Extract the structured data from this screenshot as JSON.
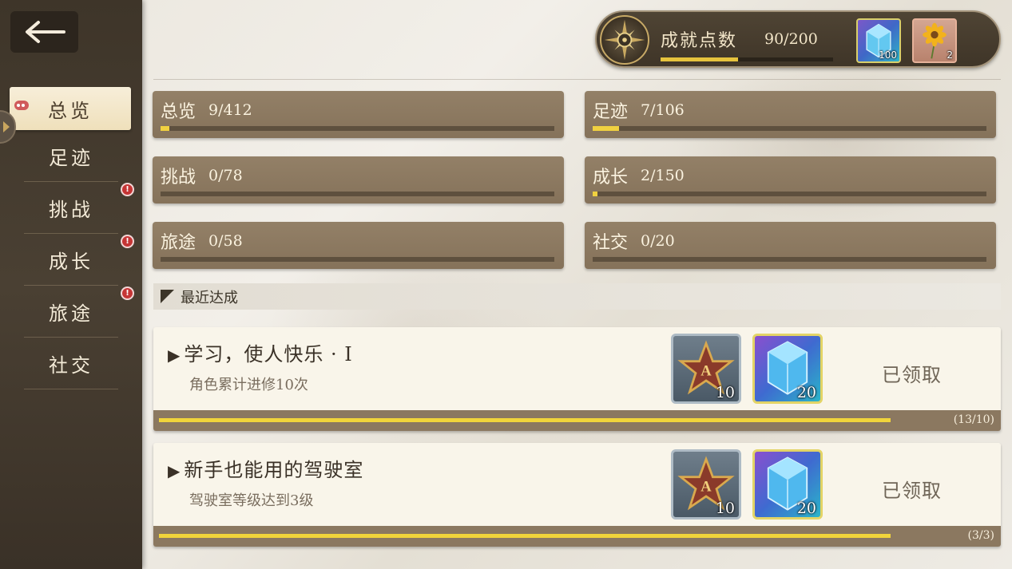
{
  "header": {
    "points_label": "成就点数",
    "points_value": "90/200",
    "points_progress": 0.45,
    "rewards": [
      {
        "icon": "blue-crystal-icon",
        "count": "100"
      },
      {
        "icon": "sunflower-icon",
        "count": "2"
      }
    ]
  },
  "sidebar": {
    "back_icon": "back-arrow-icon",
    "items": [
      {
        "label": "总览",
        "active": true,
        "alert": false
      },
      {
        "label": "足迹",
        "active": false,
        "alert": false
      },
      {
        "label": "挑战",
        "active": false,
        "alert": true
      },
      {
        "label": "成长",
        "active": false,
        "alert": true
      },
      {
        "label": "旅途",
        "active": false,
        "alert": true
      },
      {
        "label": "社交",
        "active": false,
        "alert": false
      }
    ],
    "alert_symbol": "!"
  },
  "categories": [
    {
      "name": "总览",
      "count": "9/412",
      "progress": 0.022
    },
    {
      "name": "足迹",
      "count": "7/106",
      "progress": 0.066
    },
    {
      "name": "挑战",
      "count": "0/78",
      "progress": 0
    },
    {
      "name": "成长",
      "count": "2/150",
      "progress": 0.013
    },
    {
      "name": "旅途",
      "count": "0/58",
      "progress": 0
    },
    {
      "name": "社交",
      "count": "0/20",
      "progress": 0
    }
  ],
  "recent": {
    "title": "最近达成",
    "achievements": [
      {
        "title": "学习，使人快乐 · Ⅰ",
        "desc": "角色累计进修10次",
        "rewards": [
          {
            "icon": "a-rank-star-icon",
            "count": "10"
          },
          {
            "icon": "blue-crystal-icon",
            "count": "20"
          }
        ],
        "status": "已领取",
        "progress_text": "(13/10)",
        "progress": 1.0
      },
      {
        "title": "新手也能用的驾驶室",
        "desc": "驾驶室等级达到3级",
        "rewards": [
          {
            "icon": "a-rank-star-icon",
            "count": "10"
          },
          {
            "icon": "blue-crystal-icon",
            "count": "20"
          }
        ],
        "status": "已领取",
        "progress_text": "(3/3)",
        "progress": 1.0
      }
    ]
  },
  "colors": {
    "accent_gold": "#f0d140",
    "panel_brown": "#8b7860",
    "sidebar_dark": "#3e3529",
    "alert_red": "#c53535"
  }
}
